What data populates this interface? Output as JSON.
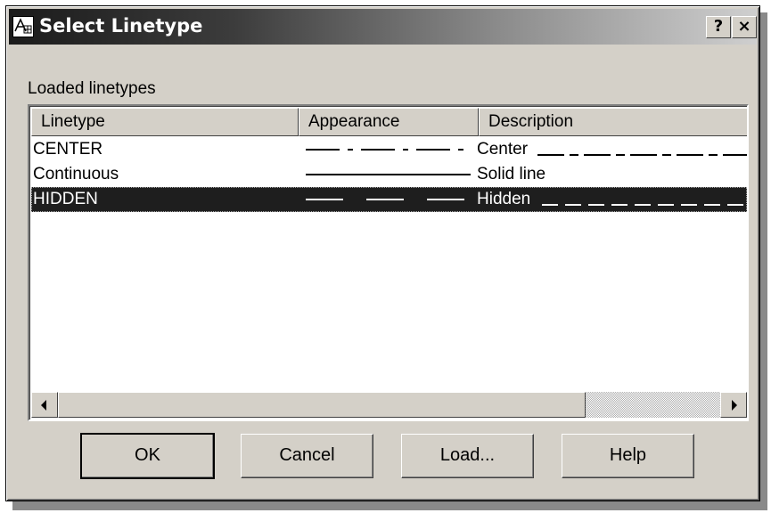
{
  "window": {
    "title": "Select Linetype",
    "help_label": "?",
    "close_label": "×"
  },
  "group_label": "Loaded linetypes",
  "columns": [
    "Linetype",
    "Appearance",
    "Description"
  ],
  "rows": [
    {
      "name": "CENTER",
      "description": "Center",
      "appearance": "center",
      "selected": false
    },
    {
      "name": "Continuous",
      "description": "Solid line",
      "appearance": "continuous",
      "selected": false
    },
    {
      "name": "HIDDEN",
      "description": "Hidden",
      "appearance": "hidden",
      "selected": true
    }
  ],
  "buttons": {
    "ok": "OK",
    "cancel": "Cancel",
    "load": "Load...",
    "help": "Help"
  },
  "colors": {
    "titlebar_dark": "#1b1b1b",
    "selection": "#1e1e1e",
    "face": "#d4d0c8"
  }
}
